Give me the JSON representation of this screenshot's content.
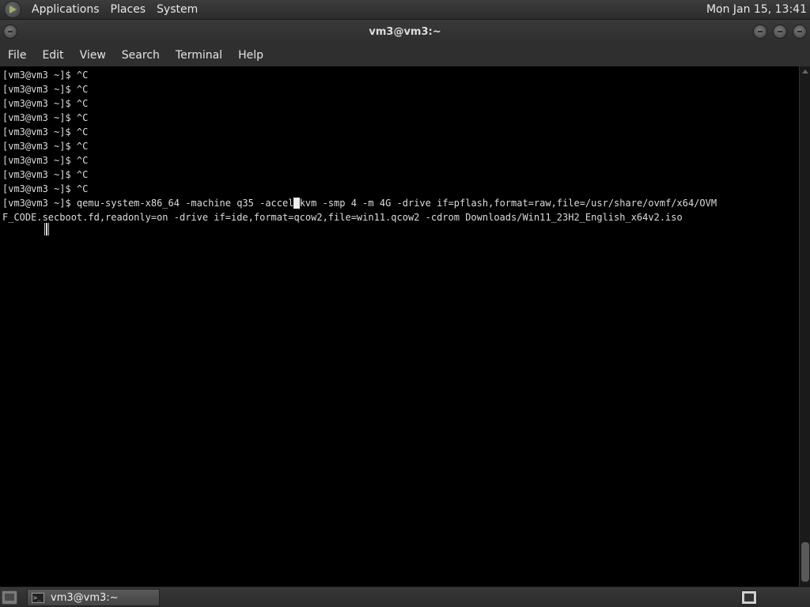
{
  "top_panel": {
    "menus": [
      "Applications",
      "Places",
      "System"
    ],
    "clock": "Mon Jan 15, 13:41"
  },
  "window": {
    "title": "vm3@vm3:~"
  },
  "menubar": {
    "items": [
      "File",
      "Edit",
      "View",
      "Search",
      "Terminal",
      "Help"
    ]
  },
  "terminal": {
    "prompt": "[vm3@vm3 ~]$ ",
    "history": [
      "[vm3@vm3 ~]$ ^C",
      "[vm3@vm3 ~]$ ^C",
      "[vm3@vm3 ~]$ ^C",
      "[vm3@vm3 ~]$ ^C",
      "[vm3@vm3 ~]$ ^C",
      "[vm3@vm3 ~]$ ^C",
      "[vm3@vm3 ~]$ ^C",
      "[vm3@vm3 ~]$ ^C",
      "[vm3@vm3 ~]$ ^C"
    ],
    "command_before_cursor": "qemu-system-x86_64 -machine q35 -accel",
    "cursor_char": " ",
    "command_after_cursor": "kvm -smp 4 -m 4G -drive if=pflash,format=raw,file=/usr/share/ovmf/x64/OVM",
    "command_wrapped": "F_CODE.secboot.fd,readonly=on -drive if=ide,format=qcow2,file=win11.qcow2 -cdrom Downloads/Win11_23H2_English_x64v2.iso"
  },
  "taskbar": {
    "tasks": [
      {
        "label": "vm3@vm3:~",
        "icon": "terminal-icon"
      }
    ]
  },
  "colors": {
    "terminal_bg": "#000000",
    "terminal_fg": "#dcdcdc",
    "panel_bg": "#2f2f2f"
  }
}
